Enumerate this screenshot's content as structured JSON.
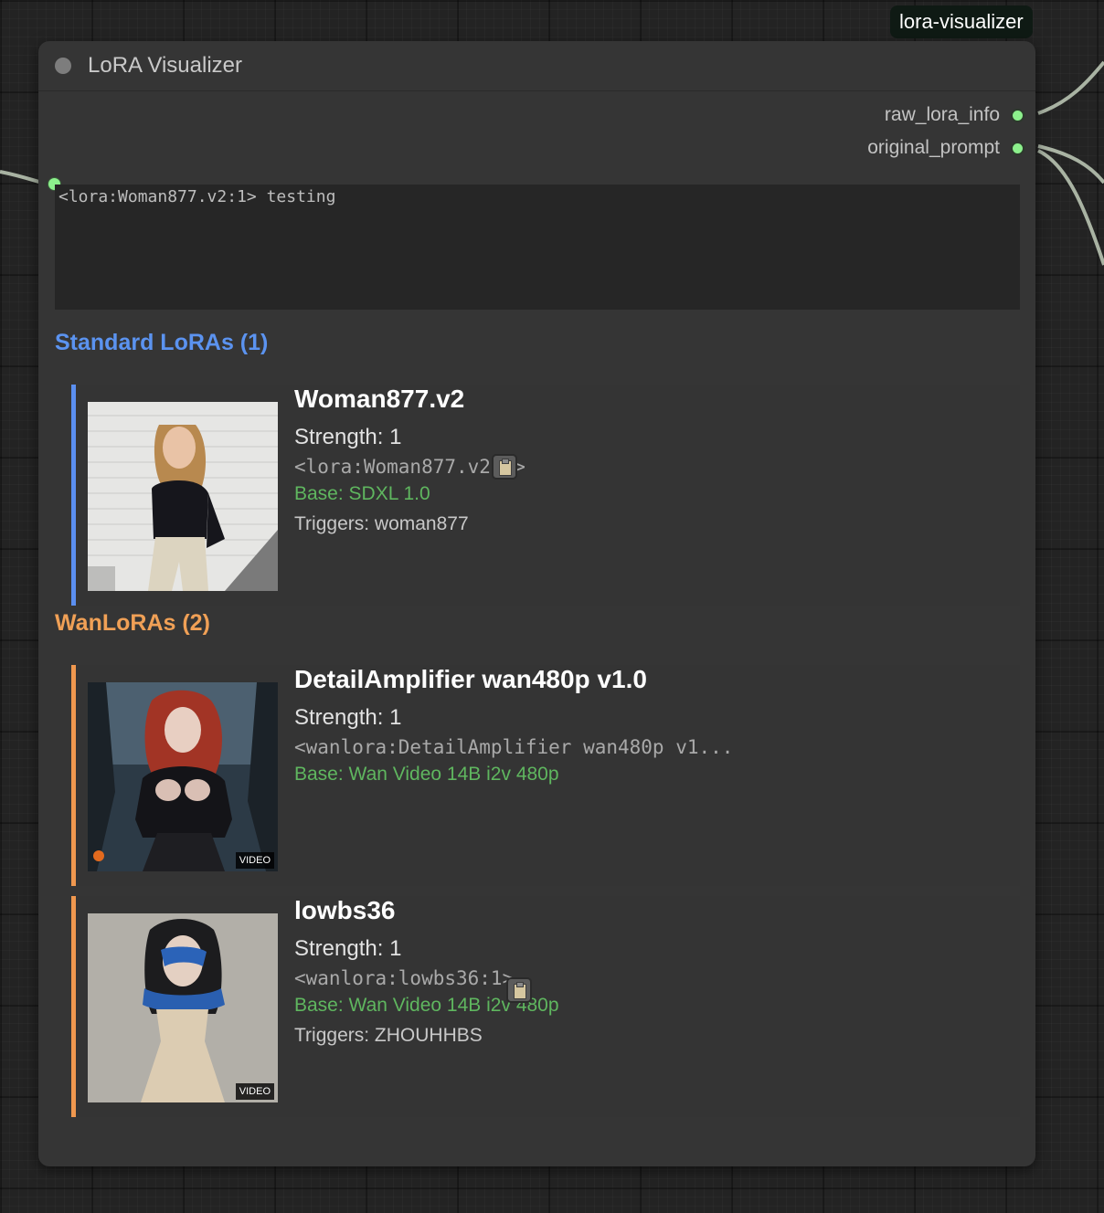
{
  "node_badge": "lora-visualizer",
  "node": {
    "title": "LoRA Visualizer",
    "outputs": [
      {
        "label": "raw_lora_info"
      },
      {
        "label": "original_prompt"
      }
    ],
    "prompt_text": "<lora:Woman877.v2:1> testing"
  },
  "sections": {
    "standard_title": "Standard LoRAs (1)",
    "wan_title": "WanLoRAs (2)"
  },
  "loras": [
    {
      "name": "Woman877.v2",
      "strength": "Strength: 1",
      "tag": "<lora:Woman877.v2:1>",
      "base": "Base: SDXL 1.0",
      "triggers": "Triggers: woman877"
    },
    {
      "name": "DetailAmplifier wan480p v1.0",
      "strength": "Strength: 1",
      "tag": "<wanlora:DetailAmplifier wan480p v1...",
      "base": "Base: Wan Video 14B i2v 480p",
      "badge": "VIDEO"
    },
    {
      "name": "lowbs36",
      "strength": "Strength: 1",
      "tag": "<wanlora:lowbs36:1>",
      "base": "Base: Wan Video 14B i2v 480p",
      "triggers": "Triggers: ZHOUHHBS",
      "badge": "VIDEO"
    }
  ],
  "colors": {
    "standard_accent": "#5b8ff0",
    "wan_accent": "#f0984f",
    "base_text": "#5fb65f",
    "slot": "#8cf08c"
  },
  "icons": {
    "copy": "clipboard-icon",
    "collapse": "collapse-dot-icon"
  }
}
